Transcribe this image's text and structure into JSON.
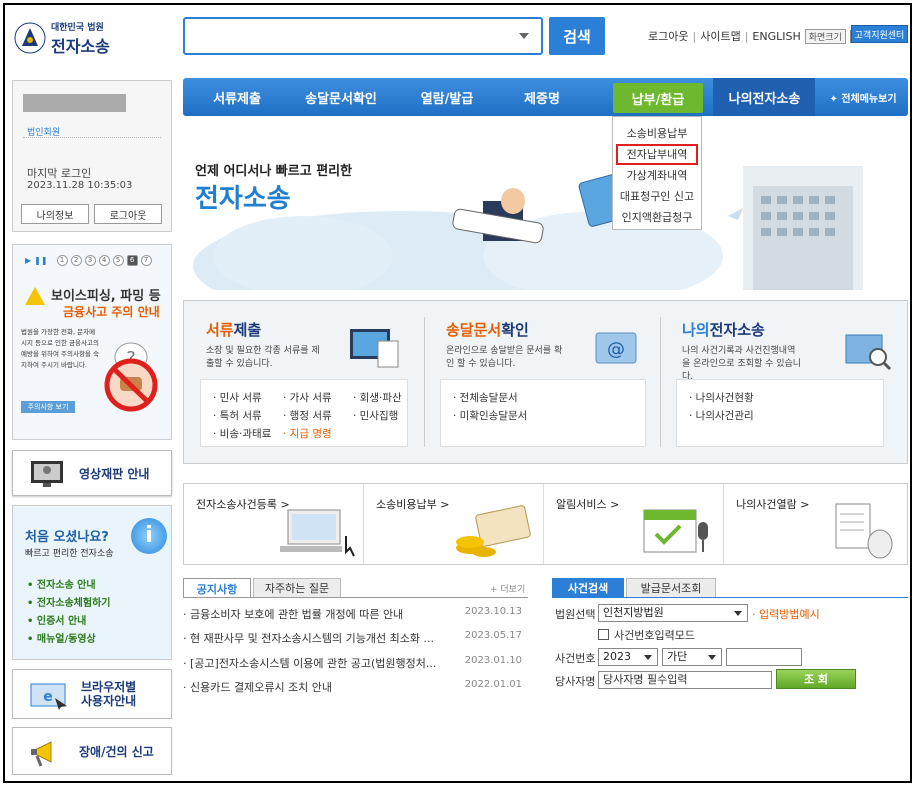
{
  "header": {
    "logo_small": "대한민국 법원",
    "logo_main": "전자소송",
    "search_placeholder": "",
    "search_button": "검색",
    "util_logout": "로그아웃",
    "util_sitemap": "사이트맵",
    "util_english": "ENGLISH",
    "util_zoom": "화면크기",
    "zoom_plus": "+",
    "zoom_minus": "-",
    "help_center": "고객지원센터"
  },
  "nav": {
    "items": [
      "서류제출",
      "송달문서확인",
      "열람/발급",
      "제증명",
      "납부/환급",
      "나의전자소송"
    ],
    "all_menu": "✦ 전체메뉴보기",
    "active": "납부/환급"
  },
  "dropdown": {
    "items": [
      "소송비용납부",
      "전자납부내역",
      "가상계좌내역",
      "대표청구인 신고",
      "인지액환급청구"
    ],
    "highlighted": "전자납부내역"
  },
  "login": {
    "member_type": "법인회원",
    "last_login_label": "마지막 로그인",
    "last_login_time": "2023.11.28 10:35:03",
    "my_info_button": "나의정보",
    "logout_button": "로그아웃"
  },
  "voice": {
    "pages": [
      "1",
      "2",
      "3",
      "4",
      "5",
      "6",
      "7"
    ],
    "title1": "보이스피싱, 파밍 등",
    "title2": "금융사고 주의 안내",
    "desc": "법원을 가장한 전화, 문자메시지 등으로 인한 금융사고의 예방을 위하여 주의사항을 숙지하여 주시기 바랍니다.",
    "more": "주의사항 보기"
  },
  "video": {
    "label": "영상재판 안내"
  },
  "first_visit": {
    "title": "처음 오셨나요?",
    "subtitle": "빠르고 편리한 전자소송",
    "links": [
      "전자소송 안내",
      "전자소송체험하기",
      "인증서 안내",
      "매뉴얼/동영상"
    ]
  },
  "browser": {
    "line1": "브라우저별",
    "line2": "사용자안내"
  },
  "report": {
    "label": "장애/건의 신고"
  },
  "hero": {
    "sub": "언제 어디서나 빠르고 편리한",
    "main": "전자소송"
  },
  "services": {
    "filing": {
      "title_hl": "서류",
      "title_rest": "제출",
      "desc": "소장 및 필요한 각종 서류를 제출할 수 있습니다.",
      "col1": [
        "· 민사 서류",
        "· 특허 서류",
        "· 비송·과태료"
      ],
      "col2": [
        "· 가사 서류",
        "· 행정 서류",
        "· 지급 명령"
      ],
      "col3": [
        "· 회생·파산",
        "· 민사집행"
      ]
    },
    "delivery": {
      "title_hl": "송달문서",
      "title_rest": "확인",
      "desc": "온라인으로 송달받은 문서를 확인 할 수 있습니다.",
      "links": [
        "· 전체송달문서",
        "· 미확인송달문서"
      ]
    },
    "mycase": {
      "title_hl": "나의",
      "title_rest": "전자소송",
      "desc": "나의 사건기록과 사건진행내역을 온라인으로 조회할 수 있습니다.",
      "links": [
        "· 나의사건현황",
        "· 나의사건관리"
      ]
    }
  },
  "quick": [
    "전자소송사건등록 >",
    "소송비용납부 >",
    "알림서비스 >",
    "나의사건열람 >"
  ],
  "notice": {
    "tab_notice": "공지사항",
    "tab_faq": "자주하는 질문",
    "more": "+ 더보기",
    "rows": [
      {
        "title": "· 금융소비자 보호에 관한 법률 개정에 따른 안내",
        "date": "2023.10.13"
      },
      {
        "title": "· 현 재판사무 및 전자소송시스템의 기능개선 최소화 ...",
        "date": "2023.05.17"
      },
      {
        "title": "· [공고]전자소송시스템 이용에 관한 공고(법원행정처...",
        "date": "2023.01.10"
      },
      {
        "title": "· 신용카드 결제오류시 조치 안내",
        "date": "2022.01.01"
      }
    ]
  },
  "case_search": {
    "tab_case": "사건검색",
    "tab_doc": "발급문서조회",
    "court_label": "법원선택",
    "court_value": "인천지방법원",
    "input_example": "· 입력방법예시",
    "case_mode": "사건번호입력모드",
    "case_no_label": "사건번호",
    "year_value": "2023",
    "type_value": "가단",
    "party_label": "당사자명",
    "party_placeholder": "당사자명 필수입력",
    "query_button": "조 회"
  }
}
